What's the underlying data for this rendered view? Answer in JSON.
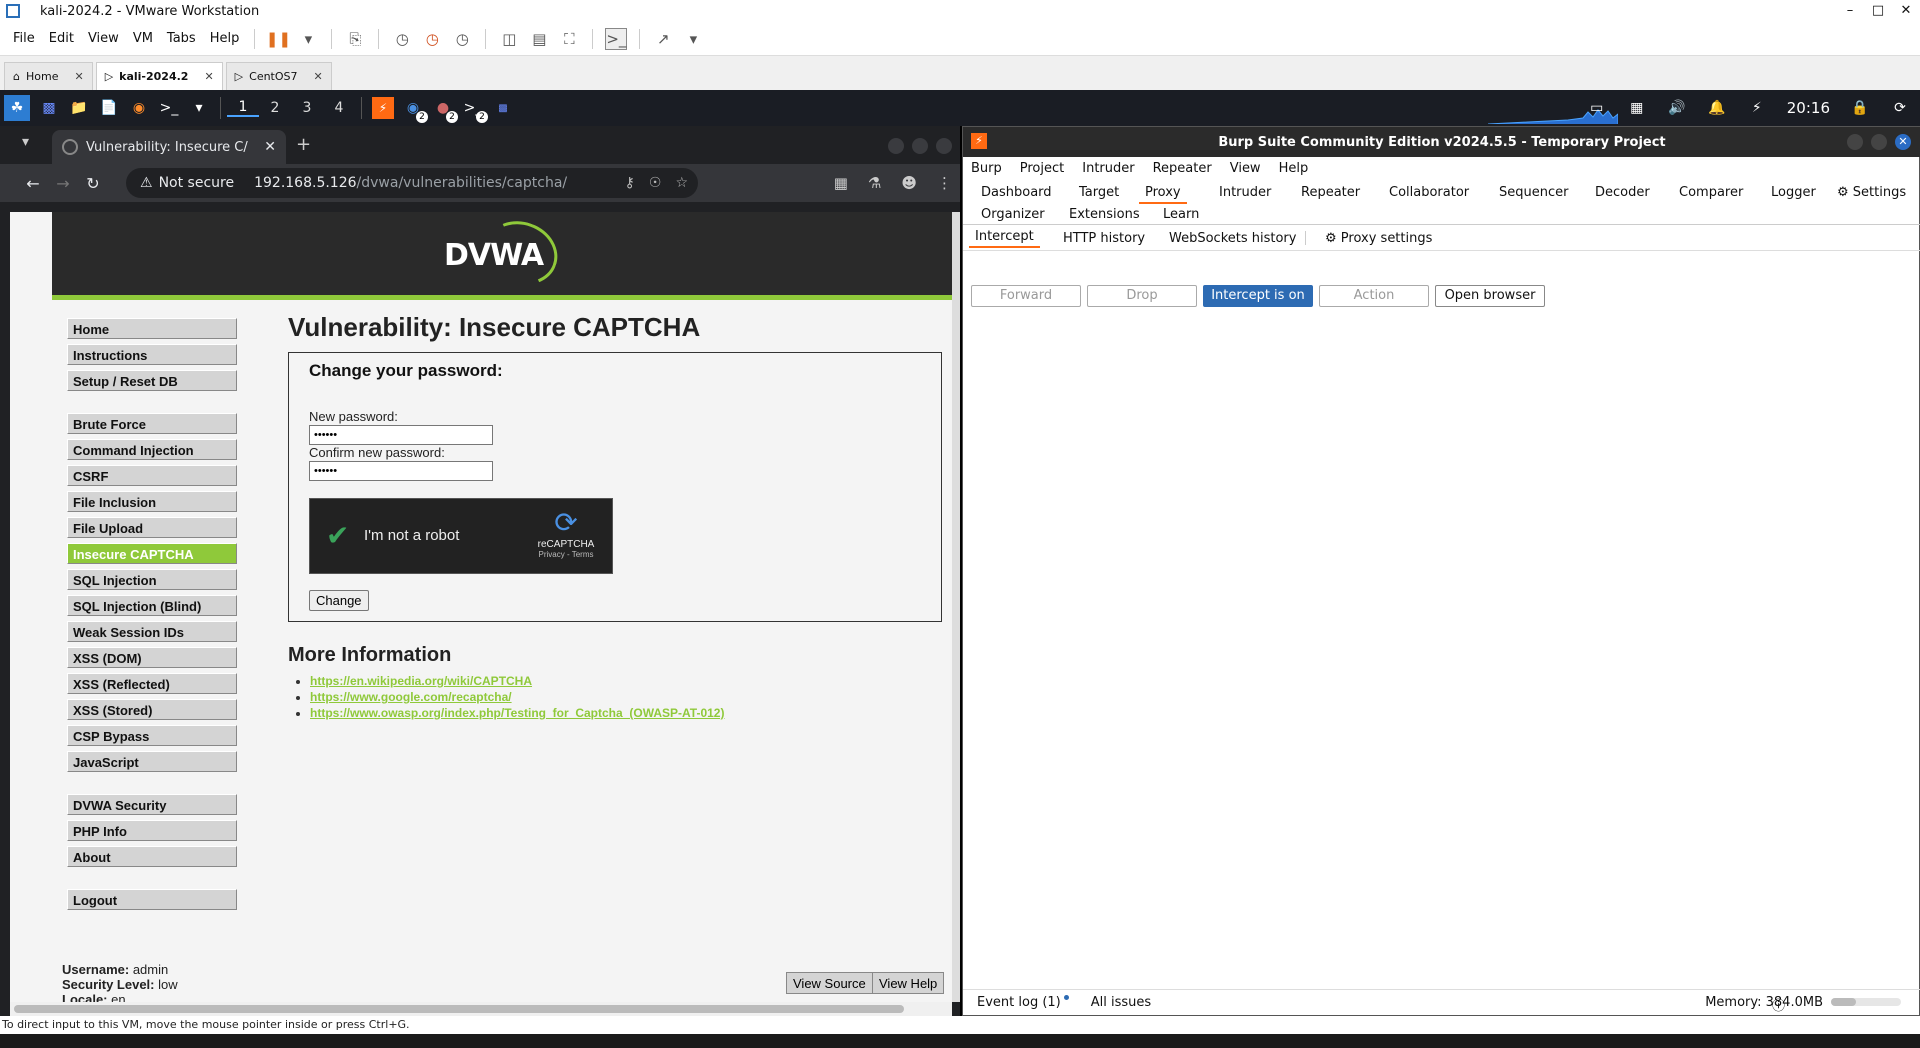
{
  "vmware": {
    "title": "kali-2024.2 - VMware Workstation",
    "menu": [
      "File",
      "Edit",
      "View",
      "VM",
      "Tabs",
      "Help"
    ],
    "tabs": [
      {
        "label": "Home",
        "active": false
      },
      {
        "label": "kali-2024.2",
        "active": true
      },
      {
        "label": "CentOS7",
        "active": false
      }
    ],
    "status_text": "To direct input to this VM, move the mouse pointer inside or press Ctrl+G."
  },
  "kali": {
    "workspaces": [
      "1",
      "2",
      "3",
      "4"
    ],
    "badges": [
      "2",
      "2",
      "2"
    ],
    "clock": "20:16"
  },
  "chrome": {
    "tab_title": "Vulnerability: Insecure C/",
    "security": "Not secure",
    "url_host": "192.168.5.126",
    "url_path": "/dvwa/vulnerabilities/captcha/"
  },
  "dvwa": {
    "logo": "DVWA",
    "menu_group1": [
      "Home",
      "Instructions",
      "Setup / Reset DB"
    ],
    "menu_group2": [
      "Brute Force",
      "Command Injection",
      "CSRF",
      "File Inclusion",
      "File Upload",
      "Insecure CAPTCHA",
      "SQL Injection",
      "SQL Injection (Blind)",
      "Weak Session IDs",
      "XSS (DOM)",
      "XSS (Reflected)",
      "XSS (Stored)",
      "CSP Bypass",
      "JavaScript"
    ],
    "menu_group3": [
      "DVWA Security",
      "PHP Info",
      "About"
    ],
    "menu_group4": [
      "Logout"
    ],
    "selected": "Insecure CAPTCHA",
    "page_title": "Vulnerability: Insecure CAPTCHA",
    "form_title": "Change your password:",
    "new_pw_label": "New password:",
    "new_pw_value": "••••••",
    "confirm_pw_label": "Confirm new password:",
    "confirm_pw_value": "••••••",
    "captcha_text": "I'm not a robot",
    "captcha_brand": "reCAPTCHA",
    "captcha_terms": "Privacy - Terms",
    "change_button": "Change",
    "more_title": "More Information",
    "links": [
      "https://en.wikipedia.org/wiki/CAPTCHA",
      "https://www.google.com/recaptcha/",
      "https://www.owasp.org/index.php/Testing_for_Captcha_(OWASP-AT-012)"
    ],
    "footer": {
      "username_label": "Username:",
      "username": "admin",
      "security_label": "Security Level:",
      "security": "low",
      "locale_label": "Locale:",
      "locale": "en"
    },
    "view_source": "View Source",
    "view_help": "View Help"
  },
  "burp": {
    "title": "Burp Suite Community Edition v2024.5.5 - Temporary Project",
    "menu": [
      "Burp",
      "Project",
      "Intruder",
      "Repeater",
      "View",
      "Help"
    ],
    "tabs_row1": [
      "Dashboard",
      "Target",
      "Proxy",
      "Intruder",
      "Repeater",
      "Collaborator",
      "Sequencer",
      "Decoder",
      "Comparer",
      "Logger",
      "Settings"
    ],
    "tabs_row2": [
      "Organizer",
      "Extensions",
      "Learn"
    ],
    "active_tab": "Proxy",
    "subtabs": [
      "Intercept",
      "HTTP history",
      "WebSockets history"
    ],
    "proxy_settings": "Proxy settings",
    "buttons": {
      "forward": "Forward",
      "drop": "Drop",
      "intercept": "Intercept is on",
      "action": "Action",
      "open_browser": "Open browser"
    },
    "event_log": "Event log (1)",
    "all_issues": "All issues",
    "memory": "Memory: 384.0MB",
    "memory_fraction": 0.36,
    "accent_color": "#ff6a13"
  }
}
